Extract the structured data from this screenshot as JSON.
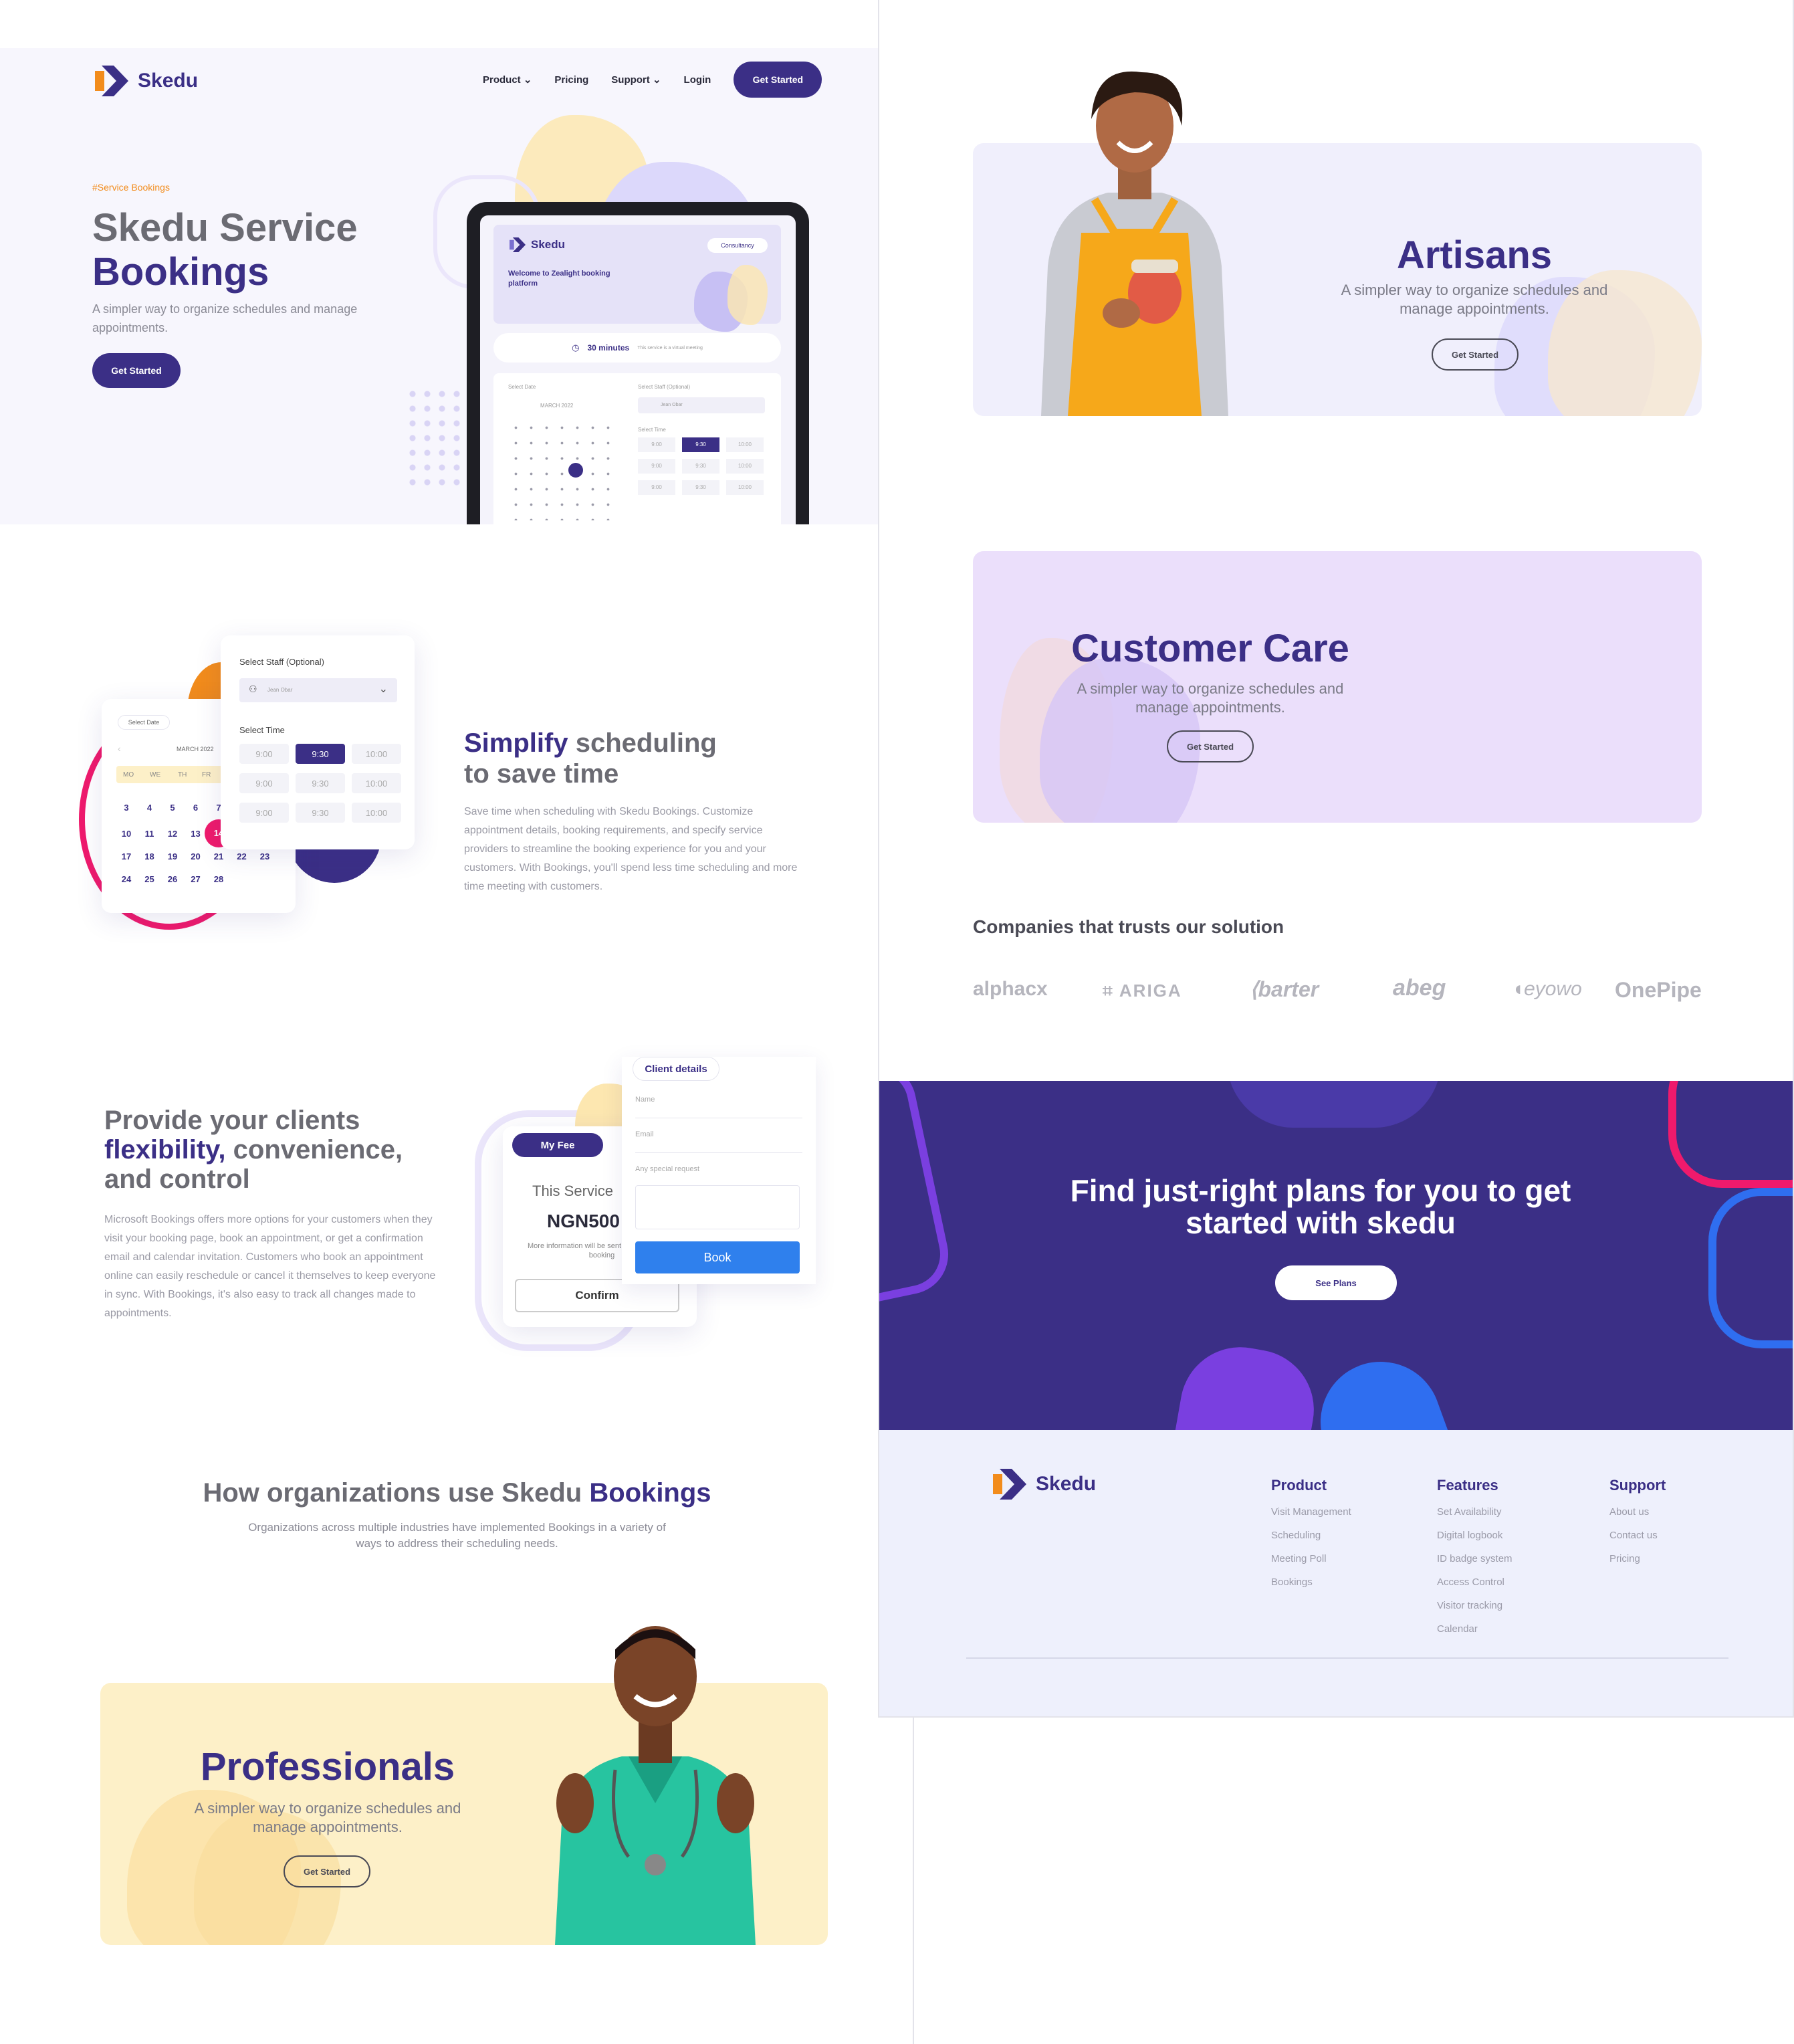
{
  "brand": {
    "name": "Skedu"
  },
  "nav": {
    "product": "Product",
    "pricing": "Pricing",
    "support": "Support",
    "login": "Login",
    "cta": "Get Started"
  },
  "hero": {
    "tag": "#Service Bookings",
    "title_line1": "Skedu Service",
    "title_line2": "Bookings",
    "subtitle": "A simpler way to organize schedules and manage appointments.",
    "cta": "Get Started"
  },
  "tablet": {
    "brand": "Skedu",
    "badge": "Consultancy",
    "welcome": "Welcome to Zealight booking platform",
    "duration": "30 minutes",
    "duration_note": "This service is a virtual meeting",
    "select_date": "Select Date",
    "select_staff": "Select Staff (Optional)",
    "staff_value": "Jean Obar",
    "select_time": "Select Time",
    "month": "MARCH 2022"
  },
  "simplify": {
    "title_accent": "Simplify",
    "title_rest": " scheduling",
    "title_line2": "to save time",
    "body": "Save time when scheduling with Skedu Bookings. Customize appointment details, booking requirements, and specify service providers to streamline the booking experience for you and your customers. With Bookings, you'll spend less time scheduling and more time meeting with customers."
  },
  "widget": {
    "select_staff": "Select Staff  (Optional)",
    "staff_value": "Jean Obar",
    "select_time": "Select Time",
    "select_date": "Select Date",
    "month": "MARCH 2022",
    "weekdays": [
      "MO",
      "WE",
      "TH",
      "FR"
    ],
    "times": [
      [
        "9:00",
        "9:30",
        "10:00"
      ],
      [
        "9:00",
        "9:30",
        "10:00"
      ],
      [
        "9:00",
        "9:30",
        "10:00"
      ]
    ],
    "days_row1": [
      "3",
      "4",
      "5",
      "6",
      "7"
    ],
    "days_row2": [
      "10",
      "11",
      "12",
      "13",
      "14"
    ],
    "days_row3": [
      "17",
      "18",
      "19",
      "20",
      "21",
      "22",
      "23"
    ],
    "days_row4": [
      "24",
      "25",
      "26",
      "27",
      "28"
    ]
  },
  "provide": {
    "line1": "Provide your clients",
    "line2_accent": "flexibility,",
    "line2_rest": " convenience,",
    "line3": "and control",
    "body": "Microsoft Bookings offers more options for your customers when they visit your booking page, book an appointment, or get a confirmation email and calendar invitation. Customers who book an appointment online can easily reschedule or cancel it themselves to keep everyone in sync. With Bookings, it's also easy to track all changes made to appointments."
  },
  "booking_widget": {
    "fee_badge": "My Fee",
    "service_label": "This Service",
    "price": "NGN500",
    "note": "More information will be sent upon successful booking",
    "confirm": "Confirm",
    "client_details": "Client details",
    "name_ph": "Name",
    "email_ph": "Email",
    "request_ph": "Any special request",
    "book": "Book"
  },
  "orgs": {
    "title_rest": "How organizations use Skedu ",
    "title_accent": "Bookings",
    "subtitle": "Organizations across multiple industries have implemented Bookings in a variety of ways to address their scheduling needs."
  },
  "banners": {
    "professionals": {
      "title": "Professionals",
      "sub": "A simpler way to organize schedules and manage appointments.",
      "cta": "Get Started",
      "bg": "#fdf0c8"
    },
    "artisans": {
      "title": "Artisans",
      "sub": "A simpler way to organize schedules and manage appointments.",
      "cta": "Get Started",
      "bg": "#f0effc"
    },
    "customer_care": {
      "title": "Customer Care",
      "sub": "A simpler way to organize schedules and manage appointments.",
      "cta": "Get Started",
      "bg": "#ebdffb"
    }
  },
  "companies": {
    "title": "Companies that trusts our solution",
    "logos": [
      "alphacx",
      "ARIGA",
      "barter",
      "abeg",
      "eyowo",
      "OnePipe"
    ]
  },
  "plans": {
    "title": "Find just-right plans for you to get started with skedu",
    "cta": "See Plans",
    "bg": "#3b2f86"
  },
  "footer": {
    "brand": "Skedu",
    "cols": [
      {
        "title": "Product",
        "items": [
          "Visit Management",
          "Scheduling",
          "Meeting Poll",
          "Bookings"
        ]
      },
      {
        "title": "Features",
        "items": [
          "Set Availability",
          "Digital logbook",
          "ID badge system",
          "Access Control",
          "Visitor tracking",
          "Calendar"
        ]
      },
      {
        "title": "Support",
        "items": [
          "About us",
          "Contact us",
          "Pricing"
        ]
      }
    ]
  },
  "colors": {
    "primary": "#3b2f86",
    "accent_orange": "#f28c1c",
    "accent_pink": "#ef1a6c",
    "blue": "#2f80ed"
  }
}
